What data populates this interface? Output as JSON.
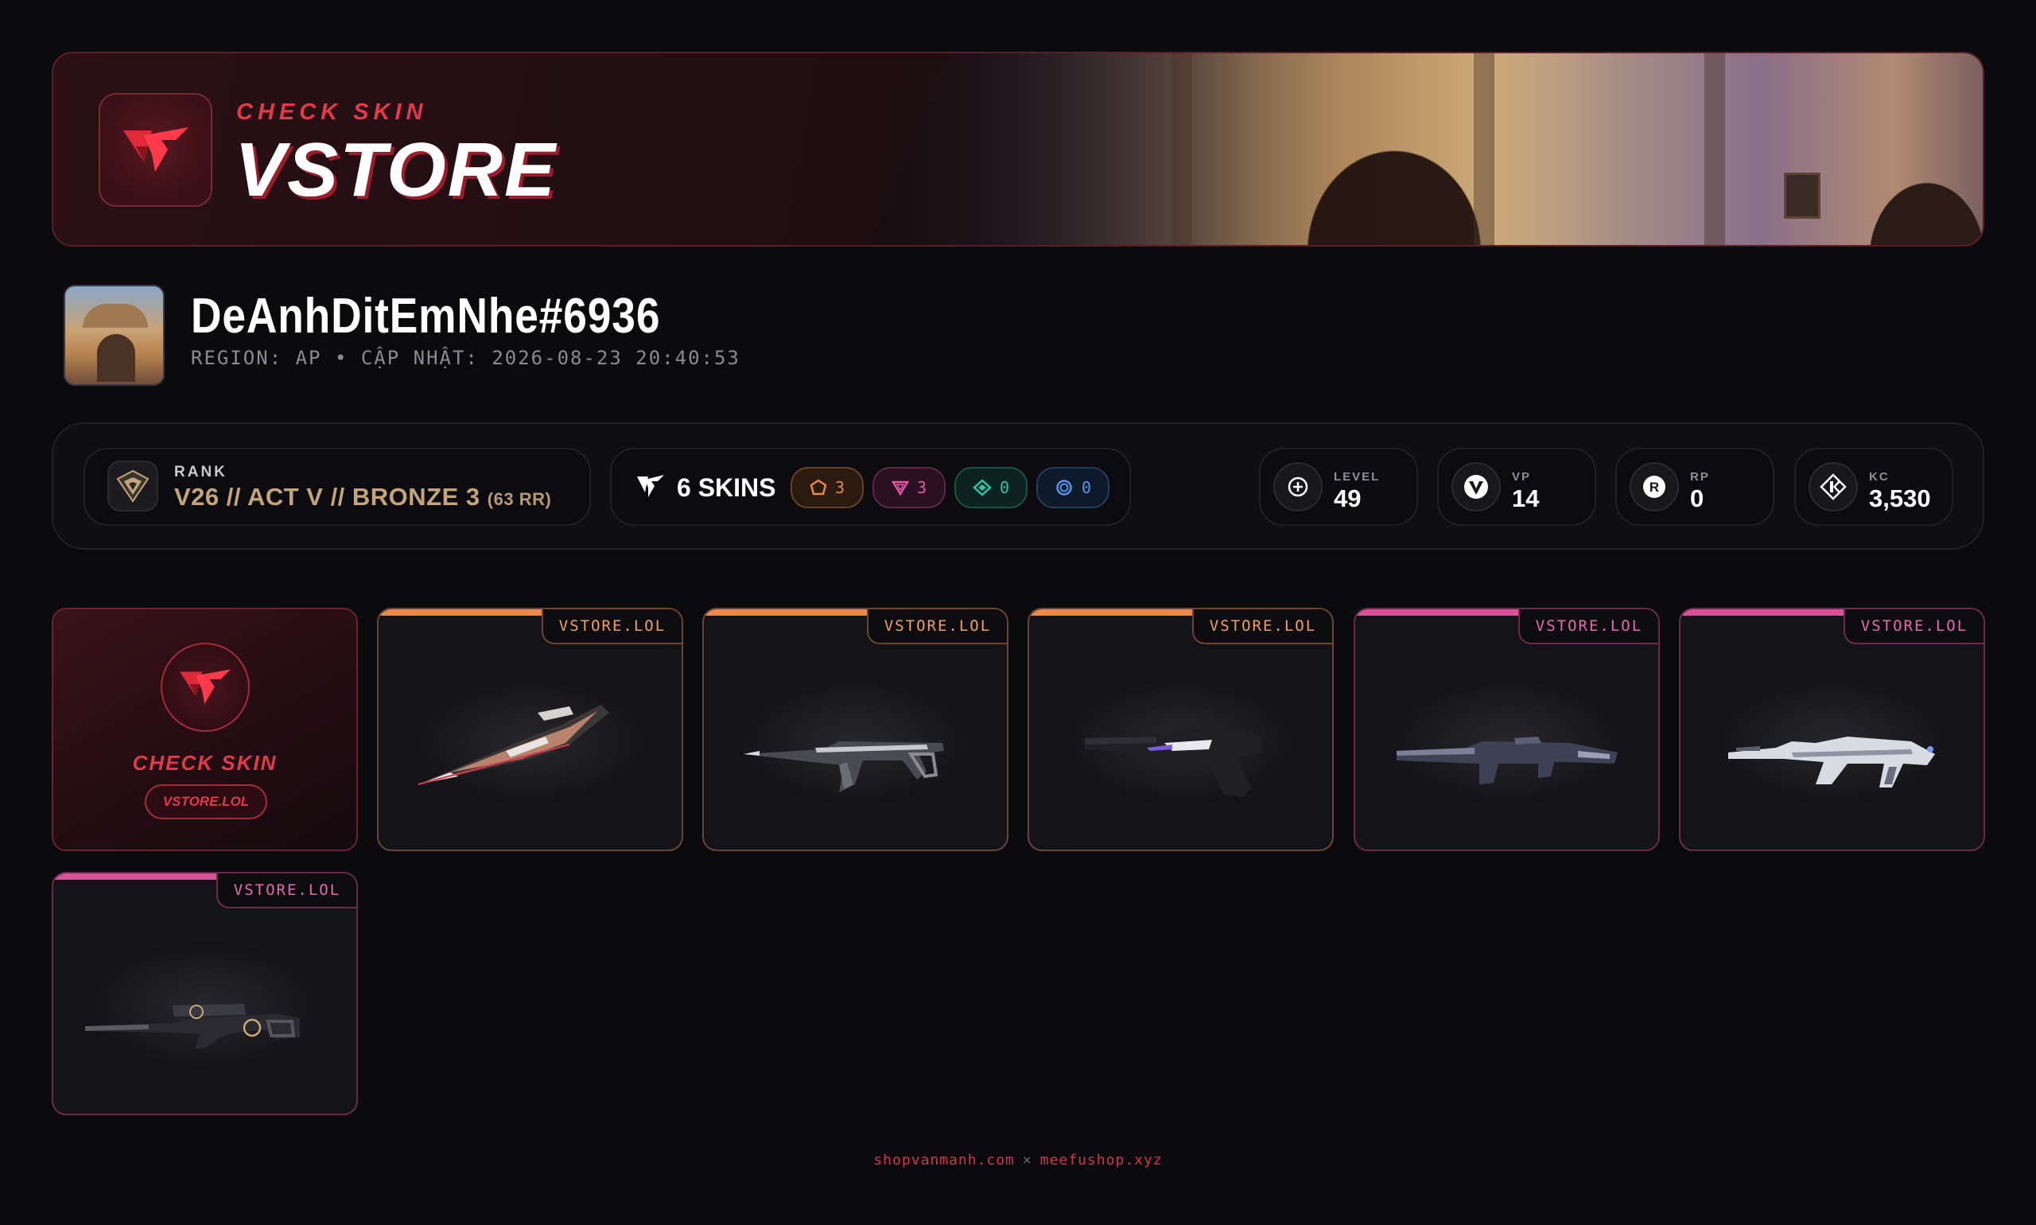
{
  "banner": {
    "subtitle": "CHECK SKIN",
    "title": "VSTORE"
  },
  "profile": {
    "name": "DeAnhDitEmNhe#6936",
    "meta": "REGION: AP • CẬP NHẬT: 2026-08-23 20:40:53"
  },
  "rank": {
    "label": "RANK",
    "value": "V26 // ACT V // BRONZE 3",
    "rr": "(63 RR)"
  },
  "skins": {
    "count_label": "6 SKINS",
    "tiers": [
      {
        "icon": "exclusive-tier-icon",
        "count": "3",
        "color": "#e8884a"
      },
      {
        "icon": "ultra-tier-icon",
        "count": "3",
        "color": "#e05aa7"
      },
      {
        "icon": "premium-tier-icon",
        "count": "0",
        "color": "#2fc6a9"
      },
      {
        "icon": "select-tier-icon",
        "count": "0",
        "color": "#5a94e8"
      }
    ]
  },
  "stats": {
    "level": {
      "label": "LEVEL",
      "value": "49"
    },
    "vp": {
      "label": "VP",
      "value": "14"
    },
    "rp": {
      "label": "RP",
      "value": "0"
    },
    "kc": {
      "label": "KC",
      "value": "3,530"
    }
  },
  "brand_card": {
    "title": "CHECK SKIN",
    "badge": "VSTORE.LOL"
  },
  "cards": [
    {
      "tag": "VSTORE.LOL",
      "tier_color": "#e98a48",
      "weapon": "knife-icon"
    },
    {
      "tag": "VSTORE.LOL",
      "tier_color": "#e98a48",
      "weapon": "spectre-icon"
    },
    {
      "tag": "VSTORE.LOL",
      "tier_color": "#e98a48",
      "weapon": "sheriff-icon"
    },
    {
      "tag": "VSTORE.LOL",
      "tier_color": "#d8529a",
      "weapon": "guardian-icon"
    },
    {
      "tag": "VSTORE.LOL",
      "tier_color": "#d8529a",
      "weapon": "vandal-icon"
    },
    {
      "tag": "VSTORE.LOL",
      "tier_color": "#d8529a",
      "weapon": "operator-icon"
    }
  ],
  "footer": {
    "left": "shopvanmanh.com",
    "sep": "×",
    "right": "meefushop.xyz"
  },
  "colors": {
    "accent": "#e23a4b",
    "background": "#0b0b0e",
    "rank_gold": "#c4a57a"
  }
}
